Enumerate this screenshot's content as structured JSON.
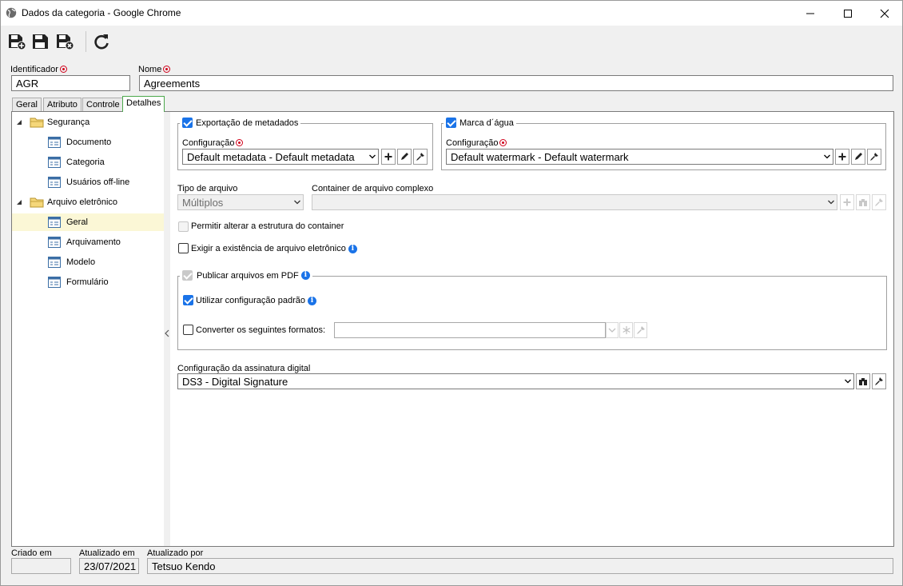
{
  "window": {
    "title": "Dados da categoria - Google Chrome"
  },
  "header": {
    "identificador_label": "Identificador",
    "identificador_value": "AGR",
    "nome_label": "Nome",
    "nome_value": "Agreements"
  },
  "tabs": [
    "Geral",
    "Atributo",
    "Controle",
    "Detalhes"
  ],
  "tree": {
    "groups": [
      {
        "label": "Segurança",
        "items": [
          "Documento",
          "Categoria",
          "Usuários off-line"
        ]
      },
      {
        "label": "Arquivo eletrônico",
        "items": [
          "Geral",
          "Arquivamento",
          "Modelo",
          "Formulário"
        ]
      }
    ],
    "selected": "Geral"
  },
  "metadata": {
    "legend": "Exportação de metadados",
    "config_label": "Configuração",
    "config_value": "Default metadata - Default metadata"
  },
  "watermark": {
    "legend": "Marca d´água",
    "config_label": "Configuração",
    "config_value": "Default watermark - Default watermark"
  },
  "file": {
    "tipo_label": "Tipo de arquivo",
    "tipo_value": "Múltiplos",
    "container_label": "Container de arquivo complexo",
    "container_value": "",
    "permitir_label": "Permitir alterar a estrutura do container",
    "exigir_label": "Exigir a existência de arquivo eletrônico"
  },
  "pdf": {
    "legend": "Publicar arquivos em PDF",
    "utilizar_label": "Utilizar configuração padrão",
    "converter_label": "Converter os seguintes formatos:",
    "converter_value": ""
  },
  "signature": {
    "label": "Configuração da assinatura digital",
    "value": "DS3 - Digital Signature"
  },
  "footer": {
    "criado_label": "Criado em",
    "criado_value": "",
    "atualizado_label": "Atualizado em",
    "atualizado_value": "23/07/2021",
    "atualizado_por_label": "Atualizado por",
    "atualizado_por_value": "Tetsuo Kendo"
  },
  "colors": {
    "accent": "#1a73e8",
    "required": "#d0021b",
    "selected_row": "#fbf7d6",
    "active_tab_border": "#4ca94c"
  }
}
